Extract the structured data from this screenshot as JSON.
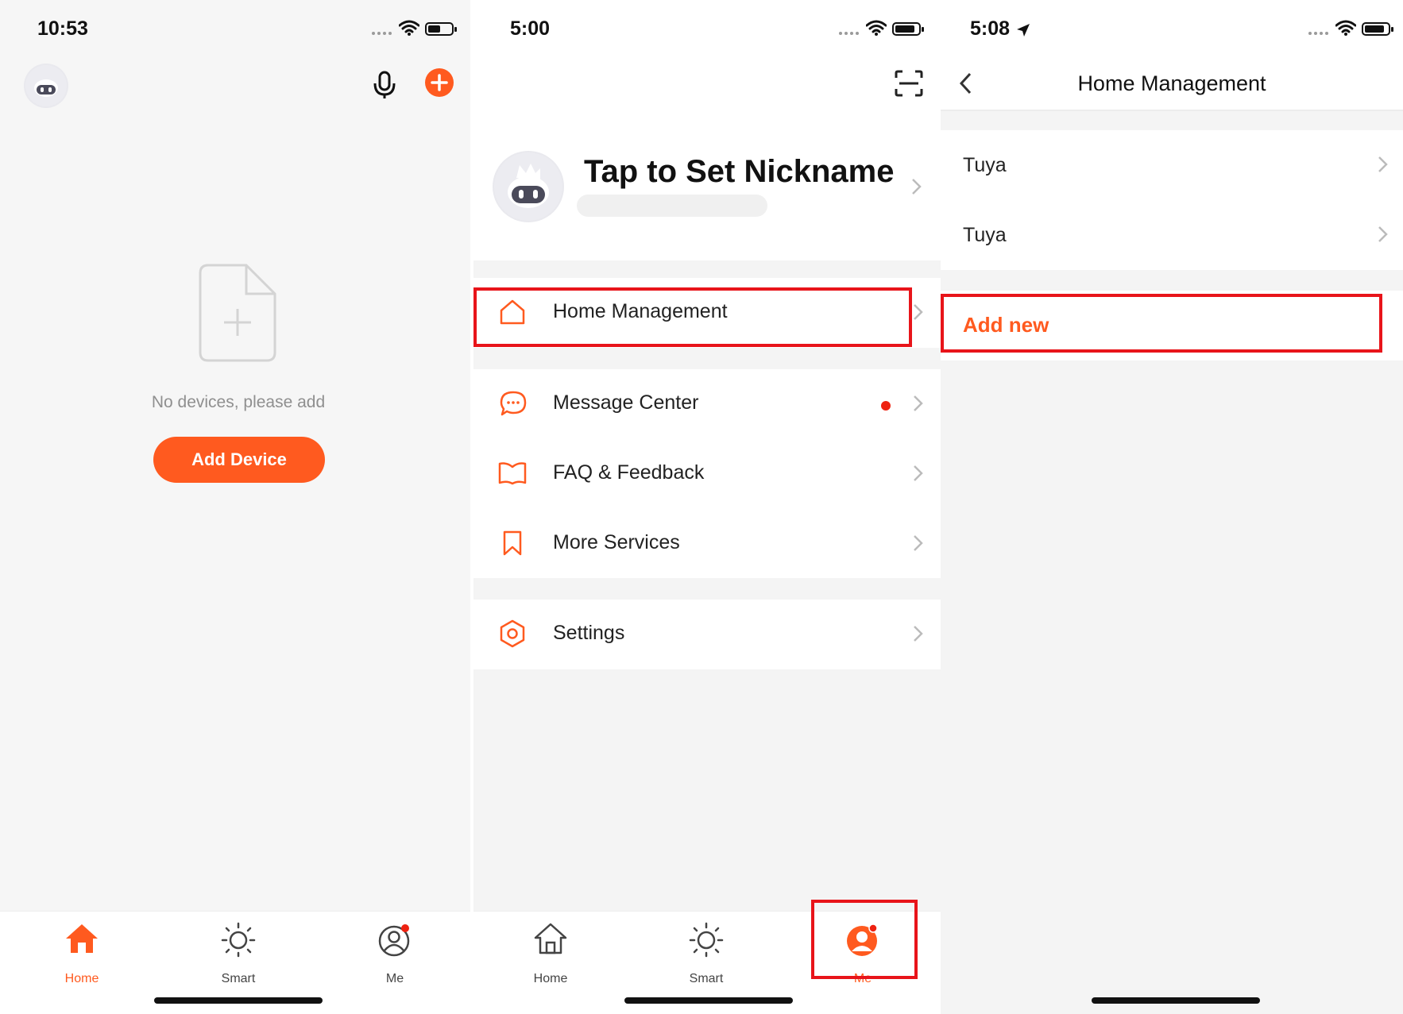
{
  "screen1": {
    "time": "10:53",
    "empty_message": "No devices, please add",
    "add_device_label": "Add Device",
    "tabs": [
      "Home",
      "Smart",
      "Me"
    ]
  },
  "screen2": {
    "time": "5:00",
    "nickname_prompt": "Tap to Set Nickname",
    "menu": {
      "home_management": "Home Management",
      "message_center": "Message Center",
      "faq_feedback": "FAQ & Feedback",
      "more_services": "More Services",
      "settings": "Settings"
    },
    "tabs": [
      "Home",
      "Smart",
      "Me"
    ]
  },
  "screen3": {
    "time": "5:08",
    "title": "Home Management",
    "homes": [
      "Tuya",
      "Tuya"
    ],
    "add_new_label": "Add new"
  },
  "colors": {
    "accent": "#ff5a1f",
    "highlight_box": "#e8141a",
    "notification_dot": "#ee2211"
  },
  "icons": [
    "avatar-robot",
    "microphone",
    "plus-circle",
    "add-file",
    "scan",
    "house",
    "chat-bubble",
    "open-book",
    "bookmark",
    "hexagon-gear",
    "sun",
    "person-circle",
    "chevron-right",
    "chevron-left",
    "location-arrow",
    "wifi",
    "battery"
  ]
}
